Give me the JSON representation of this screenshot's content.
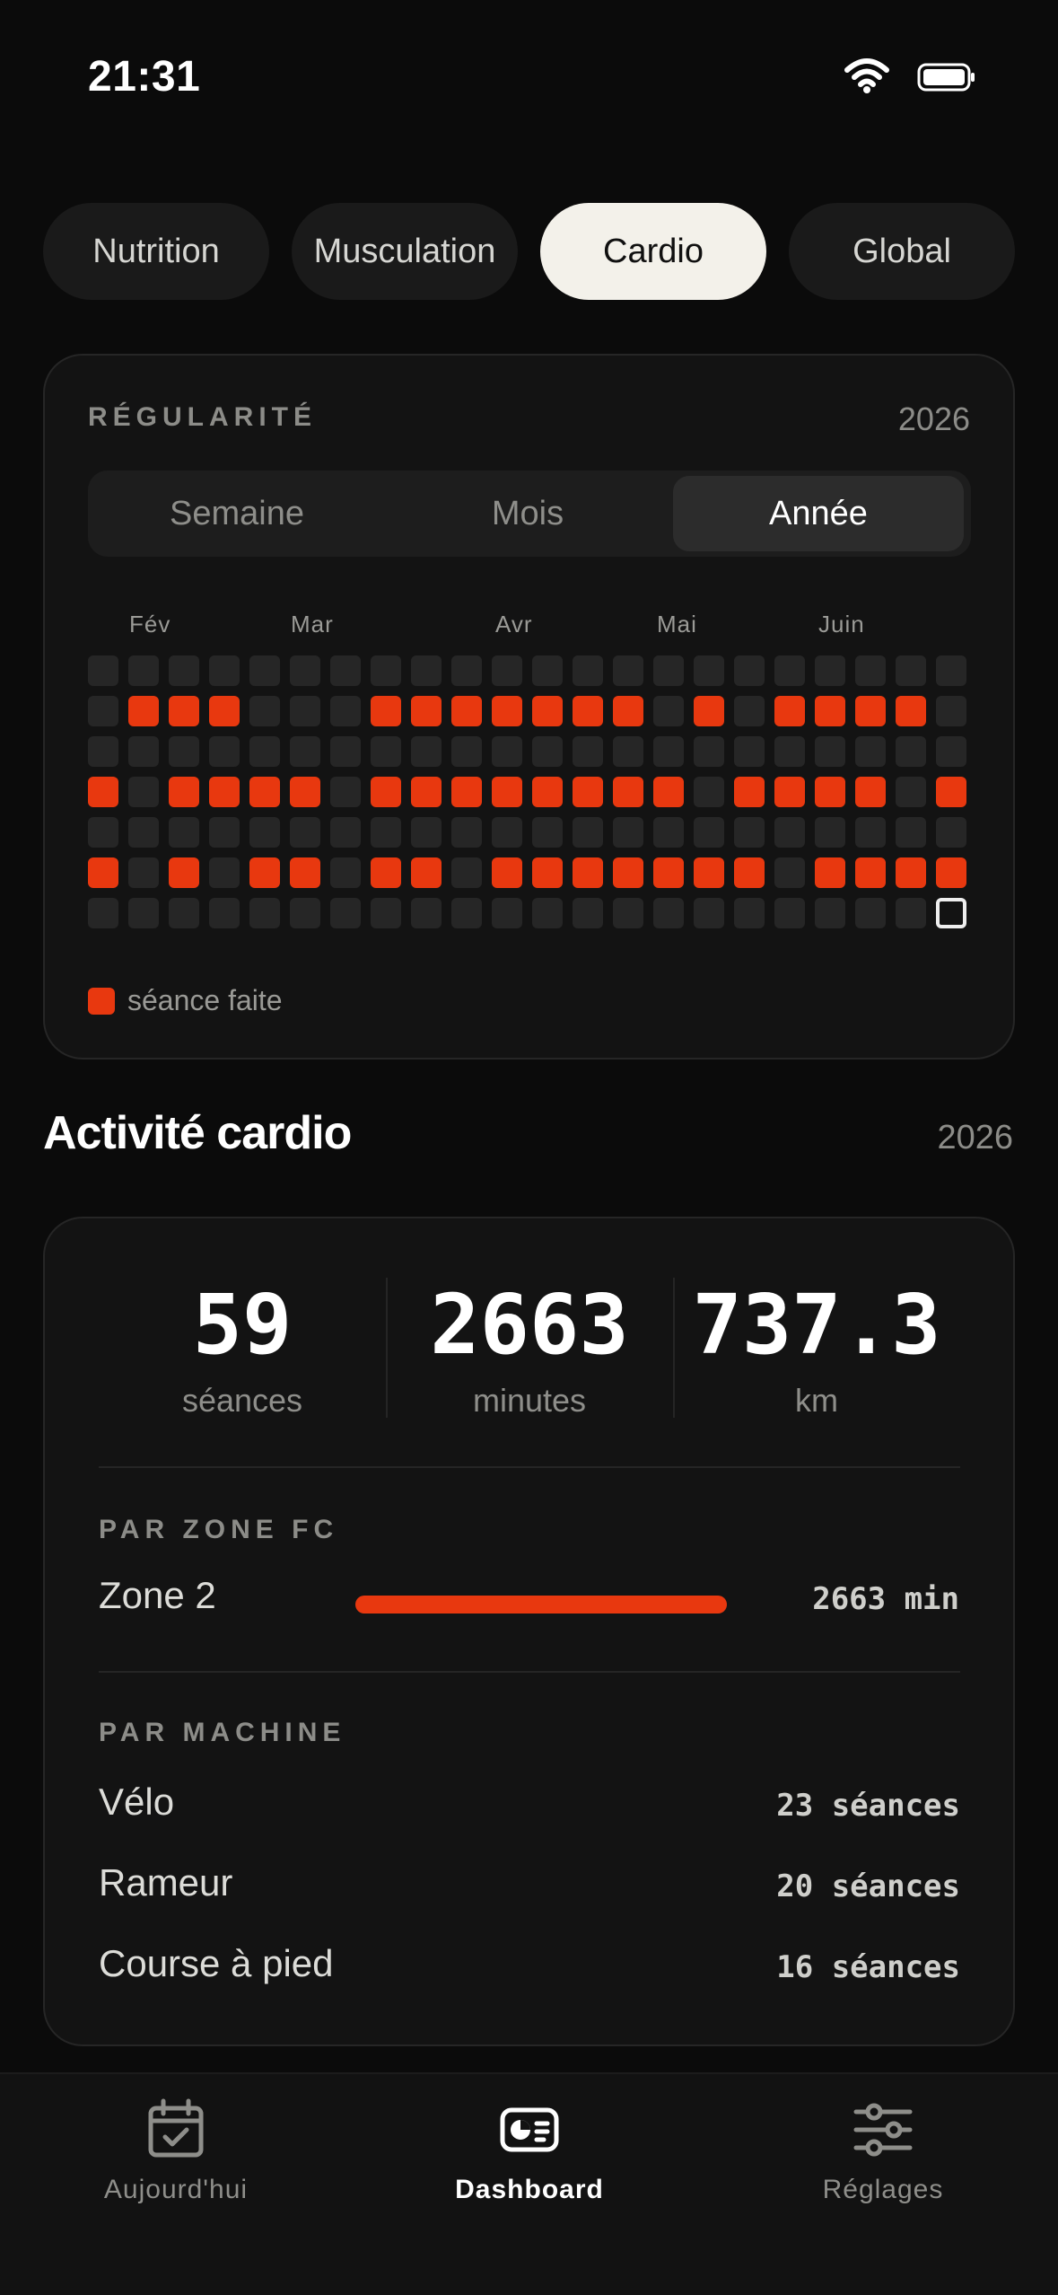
{
  "status_bar": {
    "time": "21:31"
  },
  "tabs": [
    {
      "label": "Nutrition",
      "active": false
    },
    {
      "label": "Musculation",
      "active": false
    },
    {
      "label": "Cardio",
      "active": true
    },
    {
      "label": "Global",
      "active": false
    }
  ],
  "regularity": {
    "title": "RÉGULARITÉ",
    "year": "2026",
    "periods": [
      {
        "label": "Semaine",
        "active": false
      },
      {
        "label": "Mois",
        "active": false
      },
      {
        "label": "Année",
        "active": true
      }
    ],
    "months": [
      "Fév",
      "Mar",
      "Avr",
      "Mai",
      "Juin"
    ],
    "legend": "séance faite",
    "grid": [
      "0000000000000000000000",
      "0111000111111101011110",
      "0000000000000000000000",
      "1011110111111110111101",
      "0000000000000000000000",
      "1010110110111111101111",
      "000000000000000000000T"
    ]
  },
  "activity": {
    "title": "Activité cardio",
    "year": "2026",
    "stats": [
      {
        "value": "59",
        "label": "séances"
      },
      {
        "value": "2663",
        "label": "minutes"
      },
      {
        "value": "737.3",
        "label": "km"
      }
    ],
    "zones": {
      "title": "PAR ZONE FC",
      "items": [
        {
          "name": "Zone 2",
          "value": "2663 min",
          "share": 1.0
        }
      ]
    },
    "machines": {
      "title": "PAR MACHINE",
      "items": [
        {
          "name": "Vélo",
          "count": "23 séances"
        },
        {
          "name": "Rameur",
          "count": "20 séances"
        },
        {
          "name": "Course à pied",
          "count": "16 séances"
        }
      ]
    }
  },
  "nav": [
    {
      "label": "Aujourd'hui",
      "icon": "calendar-check-icon",
      "active": false
    },
    {
      "label": "Dashboard",
      "icon": "dashboard-icon",
      "active": true
    },
    {
      "label": "Réglages",
      "icon": "sliders-icon",
      "active": false
    }
  ],
  "colors": {
    "accent": "#e8380f",
    "background": "#0b0b0b",
    "card": "#131313",
    "empty_cell": "#262626"
  }
}
